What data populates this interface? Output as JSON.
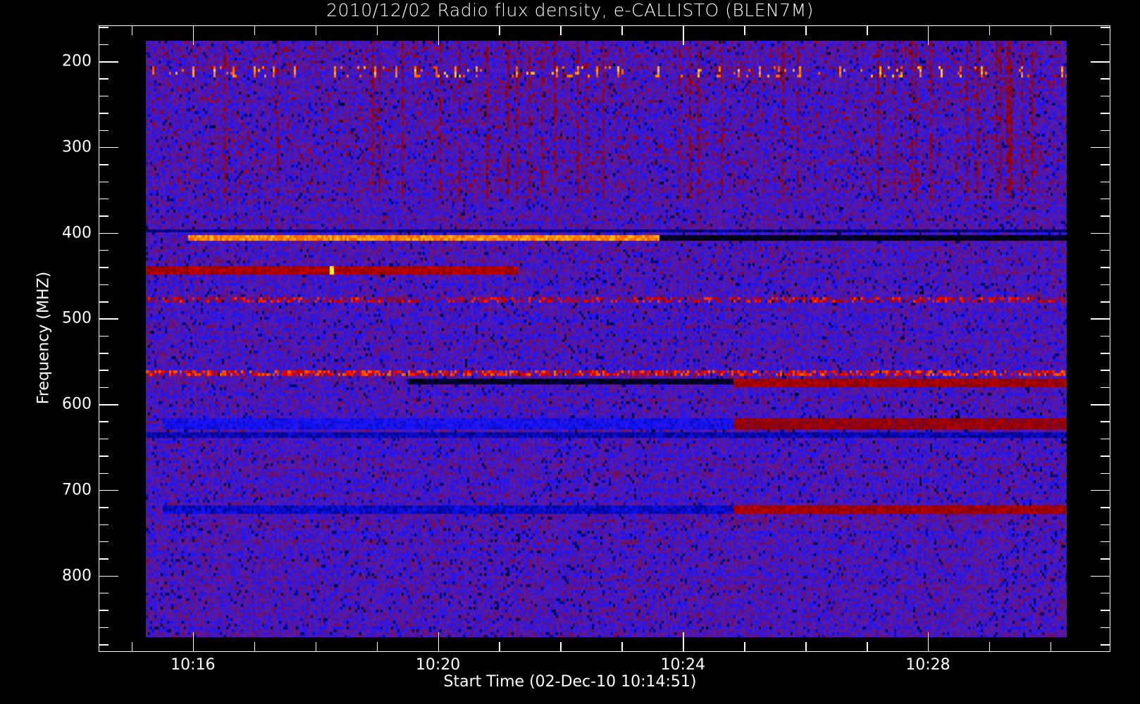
{
  "chart_data": {
    "type": "heatmap",
    "title": "2010/12/02  Radio flux density, e-CALLISTO (BLEN7M)",
    "xlabel": "Start Time (02-Dec-10 10:14:51)",
    "ylabel": "Frequency (MHZ)",
    "x_unit": "minutes after 10:14",
    "xlim": [
      0.46,
      16.98
    ],
    "ylim": [
      889,
      158
    ],
    "data_extent": {
      "x": [
        1.23,
        16.27
      ],
      "y": [
        176,
        872
      ]
    },
    "x_ticks": [
      {
        "value": 2,
        "label": "10:16"
      },
      {
        "value": 6,
        "label": "10:20"
      },
      {
        "value": 10,
        "label": "10:24"
      },
      {
        "value": 14,
        "label": "10:28"
      }
    ],
    "x_minor_step": 1,
    "y_ticks": [
      {
        "value": 200,
        "label": "200"
      },
      {
        "value": 300,
        "label": "300"
      },
      {
        "value": 400,
        "label": "400"
      },
      {
        "value": 500,
        "label": "500"
      },
      {
        "value": 600,
        "label": "600"
      },
      {
        "value": 700,
        "label": "700"
      },
      {
        "value": 800,
        "label": "800"
      }
    ],
    "y_minor_step": 20,
    "colormap": [
      "#000000",
      "#00007a",
      "#1414ff",
      "#5a1aa8",
      "#8c0000",
      "#e60000",
      "#ff7000",
      "#ffff40"
    ],
    "background_level": 0.4,
    "features": [
      {
        "name": "periodic bursts",
        "freq": [
          205,
          216
        ],
        "t": [
          1.3,
          16.27
        ],
        "level": 0.95,
        "period": 0.33
      },
      {
        "name": "upper streaks",
        "freq": [
          176,
          350
        ],
        "t": [
          1.3,
          16.27
        ],
        "level": 0.65,
        "density": 0.05
      },
      {
        "name": "dark line",
        "freq": [
          394,
          399
        ],
        "t": [
          1.23,
          16.27
        ],
        "level": 0.15
      },
      {
        "name": "strong band",
        "freq": [
          401,
          407
        ],
        "t": [
          1.9,
          9.6
        ],
        "level": 0.88
      },
      {
        "name": "dark band",
        "freq": [
          401,
          407
        ],
        "t": [
          9.6,
          16.27
        ],
        "level": 0.03
      },
      {
        "name": "band 440",
        "freq": [
          436,
          446
        ],
        "t": [
          1.23,
          7.3
        ],
        "level": 0.62
      },
      {
        "name": "spot",
        "freq": [
          436,
          446
        ],
        "t": [
          4.2,
          4.3
        ],
        "level": 1.0
      },
      {
        "name": "speckle line",
        "freq": [
          475,
          481
        ],
        "t": [
          1.23,
          16.27
        ],
        "level": 0.8,
        "density": 0.4
      },
      {
        "name": "bright line",
        "freq": [
          559,
          565
        ],
        "t": [
          1.23,
          16.27
        ],
        "level": 0.85,
        "density": 0.6
      },
      {
        "name": "dark segment",
        "freq": [
          569,
          575
        ],
        "t": [
          5.5,
          10.8
        ],
        "level": 0.05
      },
      {
        "name": "red segment",
        "freq": [
          569,
          578
        ],
        "t": [
          10.8,
          16.27
        ],
        "level": 0.6
      },
      {
        "name": "blue band 620",
        "freq": [
          614,
          628
        ],
        "t": [
          1.5,
          10.8
        ],
        "level": 0.28
      },
      {
        "name": "red band 620",
        "freq": [
          614,
          628
        ],
        "t": [
          10.8,
          16.27
        ],
        "level": 0.58
      },
      {
        "name": "dark line 635",
        "freq": [
          632,
          637
        ],
        "t": [
          1.23,
          16.27
        ],
        "level": 0.2
      },
      {
        "name": "blue band 722",
        "freq": [
          717,
          727
        ],
        "t": [
          1.5,
          10.8
        ],
        "level": 0.22
      },
      {
        "name": "red band 722",
        "freq": [
          717,
          727
        ],
        "t": [
          10.8,
          16.27
        ],
        "level": 0.6
      }
    ]
  }
}
